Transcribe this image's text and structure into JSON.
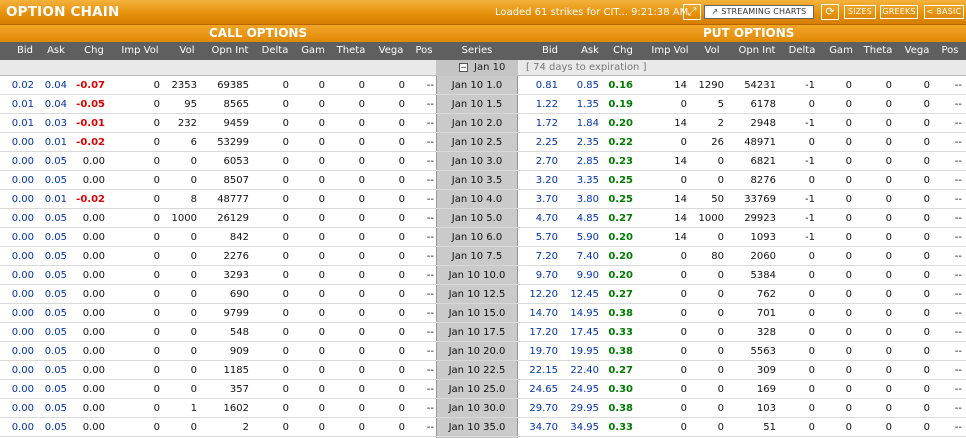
{
  "header": {
    "title": "OPTION CHAIN",
    "status": "Loaded 61 strikes for CIT... 9:21:38 AM",
    "buttons": {
      "streaming": "STREAMING CHARTS",
      "sizes": "SIZES",
      "greeks": "GREEKS",
      "basic": "< BASIC"
    }
  },
  "sections": {
    "calls": "CALL OPTIONS",
    "puts": "PUT OPTIONS"
  },
  "columns": {
    "call": [
      "Bid",
      "Ask",
      "Chg",
      "Imp Vol",
      "Vol",
      "Opn Int",
      "Delta",
      "Gam",
      "Theta",
      "Vega",
      "Pos"
    ],
    "series": "Series",
    "put": [
      "Bid",
      "Ask",
      "Chg",
      "Imp Vol",
      "Vol",
      "Opn Int",
      "Delta",
      "Gam",
      "Theta",
      "Vega",
      "Pos"
    ]
  },
  "expiration": {
    "toggle": "−",
    "label": "Jan 10",
    "days": "[ 74 days to expiration ]"
  },
  "rows": [
    {
      "series": "Jan 10 1.0",
      "call": [
        "0.02",
        "0.04",
        "-0.07",
        "0",
        "2353",
        "69385",
        "0",
        "0",
        "0",
        "0",
        "--"
      ],
      "put": [
        "0.81",
        "0.85",
        "0.16",
        "14",
        "1290",
        "54231",
        "-1",
        "0",
        "0",
        "0",
        "--"
      ]
    },
    {
      "series": "Jan 10 1.5",
      "call": [
        "0.01",
        "0.04",
        "-0.05",
        "0",
        "95",
        "8565",
        "0",
        "0",
        "0",
        "0",
        "--"
      ],
      "put": [
        "1.22",
        "1.35",
        "0.19",
        "0",
        "5",
        "6178",
        "0",
        "0",
        "0",
        "0",
        "--"
      ]
    },
    {
      "series": "Jan 10 2.0",
      "call": [
        "0.01",
        "0.03",
        "-0.01",
        "0",
        "232",
        "9459",
        "0",
        "0",
        "0",
        "0",
        "--"
      ],
      "put": [
        "1.72",
        "1.84",
        "0.20",
        "14",
        "2",
        "2948",
        "-1",
        "0",
        "0",
        "0",
        "--"
      ]
    },
    {
      "series": "Jan 10 2.5",
      "call": [
        "0.00",
        "0.01",
        "-0.02",
        "0",
        "6",
        "53299",
        "0",
        "0",
        "0",
        "0",
        "--"
      ],
      "put": [
        "2.25",
        "2.35",
        "0.22",
        "0",
        "26",
        "48971",
        "0",
        "0",
        "0",
        "0",
        "--"
      ]
    },
    {
      "series": "Jan 10 3.0",
      "call": [
        "0.00",
        "0.05",
        "0.00",
        "0",
        "0",
        "6053",
        "0",
        "0",
        "0",
        "0",
        "--"
      ],
      "put": [
        "2.70",
        "2.85",
        "0.23",
        "14",
        "0",
        "6821",
        "-1",
        "0",
        "0",
        "0",
        "--"
      ]
    },
    {
      "series": "Jan 10 3.5",
      "call": [
        "0.00",
        "0.05",
        "0.00",
        "0",
        "0",
        "8507",
        "0",
        "0",
        "0",
        "0",
        "--"
      ],
      "put": [
        "3.20",
        "3.35",
        "0.25",
        "0",
        "0",
        "8276",
        "0",
        "0",
        "0",
        "0",
        "--"
      ]
    },
    {
      "series": "Jan 10 4.0",
      "call": [
        "0.00",
        "0.01",
        "-0.02",
        "0",
        "8",
        "48777",
        "0",
        "0",
        "0",
        "0",
        "--"
      ],
      "put": [
        "3.70",
        "3.80",
        "0.25",
        "14",
        "50",
        "33769",
        "-1",
        "0",
        "0",
        "0",
        "--"
      ]
    },
    {
      "series": "Jan 10 5.0",
      "call": [
        "0.00",
        "0.05",
        "0.00",
        "0",
        "1000",
        "26129",
        "0",
        "0",
        "0",
        "0",
        "--"
      ],
      "put": [
        "4.70",
        "4.85",
        "0.27",
        "14",
        "1000",
        "29923",
        "-1",
        "0",
        "0",
        "0",
        "--"
      ]
    },
    {
      "series": "Jan 10 6.0",
      "call": [
        "0.00",
        "0.05",
        "0.00",
        "0",
        "0",
        "842",
        "0",
        "0",
        "0",
        "0",
        "--"
      ],
      "put": [
        "5.70",
        "5.90",
        "0.20",
        "14",
        "0",
        "1093",
        "-1",
        "0",
        "0",
        "0",
        "--"
      ]
    },
    {
      "series": "Jan 10 7.5",
      "call": [
        "0.00",
        "0.05",
        "0.00",
        "0",
        "0",
        "2276",
        "0",
        "0",
        "0",
        "0",
        "--"
      ],
      "put": [
        "7.20",
        "7.40",
        "0.20",
        "0",
        "80",
        "2060",
        "0",
        "0",
        "0",
        "0",
        "--"
      ]
    },
    {
      "series": "Jan 10 10.0",
      "call": [
        "0.00",
        "0.05",
        "0.00",
        "0",
        "0",
        "3293",
        "0",
        "0",
        "0",
        "0",
        "--"
      ],
      "put": [
        "9.70",
        "9.90",
        "0.20",
        "0",
        "0",
        "5384",
        "0",
        "0",
        "0",
        "0",
        "--"
      ]
    },
    {
      "series": "Jan 10 12.5",
      "call": [
        "0.00",
        "0.05",
        "0.00",
        "0",
        "0",
        "690",
        "0",
        "0",
        "0",
        "0",
        "--"
      ],
      "put": [
        "12.20",
        "12.45",
        "0.27",
        "0",
        "0",
        "762",
        "0",
        "0",
        "0",
        "0",
        "--"
      ]
    },
    {
      "series": "Jan 10 15.0",
      "call": [
        "0.00",
        "0.05",
        "0.00",
        "0",
        "0",
        "9799",
        "0",
        "0",
        "0",
        "0",
        "--"
      ],
      "put": [
        "14.70",
        "14.95",
        "0.38",
        "0",
        "0",
        "701",
        "0",
        "0",
        "0",
        "0",
        "--"
      ]
    },
    {
      "series": "Jan 10 17.5",
      "call": [
        "0.00",
        "0.05",
        "0.00",
        "0",
        "0",
        "548",
        "0",
        "0",
        "0",
        "0",
        "--"
      ],
      "put": [
        "17.20",
        "17.45",
        "0.33",
        "0",
        "0",
        "328",
        "0",
        "0",
        "0",
        "0",
        "--"
      ]
    },
    {
      "series": "Jan 10 20.0",
      "call": [
        "0.00",
        "0.05",
        "0.00",
        "0",
        "0",
        "909",
        "0",
        "0",
        "0",
        "0",
        "--"
      ],
      "put": [
        "19.70",
        "19.95",
        "0.38",
        "0",
        "0",
        "5563",
        "0",
        "0",
        "0",
        "0",
        "--"
      ]
    },
    {
      "series": "Jan 10 22.5",
      "call": [
        "0.00",
        "0.05",
        "0.00",
        "0",
        "0",
        "1185",
        "0",
        "0",
        "0",
        "0",
        "--"
      ],
      "put": [
        "22.15",
        "22.40",
        "0.27",
        "0",
        "0",
        "309",
        "0",
        "0",
        "0",
        "0",
        "--"
      ]
    },
    {
      "series": "Jan 10 25.0",
      "call": [
        "0.00",
        "0.05",
        "0.00",
        "0",
        "0",
        "357",
        "0",
        "0",
        "0",
        "0",
        "--"
      ],
      "put": [
        "24.65",
        "24.95",
        "0.30",
        "0",
        "0",
        "169",
        "0",
        "0",
        "0",
        "0",
        "--"
      ]
    },
    {
      "series": "Jan 10 30.0",
      "call": [
        "0.00",
        "0.05",
        "0.00",
        "0",
        "1",
        "1602",
        "0",
        "0",
        "0",
        "0",
        "--"
      ],
      "put": [
        "29.70",
        "29.95",
        "0.38",
        "0",
        "0",
        "103",
        "0",
        "0",
        "0",
        "0",
        "--"
      ]
    },
    {
      "series": "Jan 10 35.0",
      "call": [
        "0.00",
        "0.05",
        "0.00",
        "0",
        "0",
        "2",
        "0",
        "0",
        "0",
        "0",
        "--"
      ],
      "put": [
        "34.70",
        "34.95",
        "0.33",
        "0",
        "0",
        "51",
        "0",
        "0",
        "0",
        "0",
        "--"
      ]
    }
  ],
  "colors": {
    "accent": "#e6910b",
    "bid_ask": "#0033aa",
    "negative": "#e00000",
    "positive": "#007a00",
    "series_bg": "#cacaca"
  }
}
